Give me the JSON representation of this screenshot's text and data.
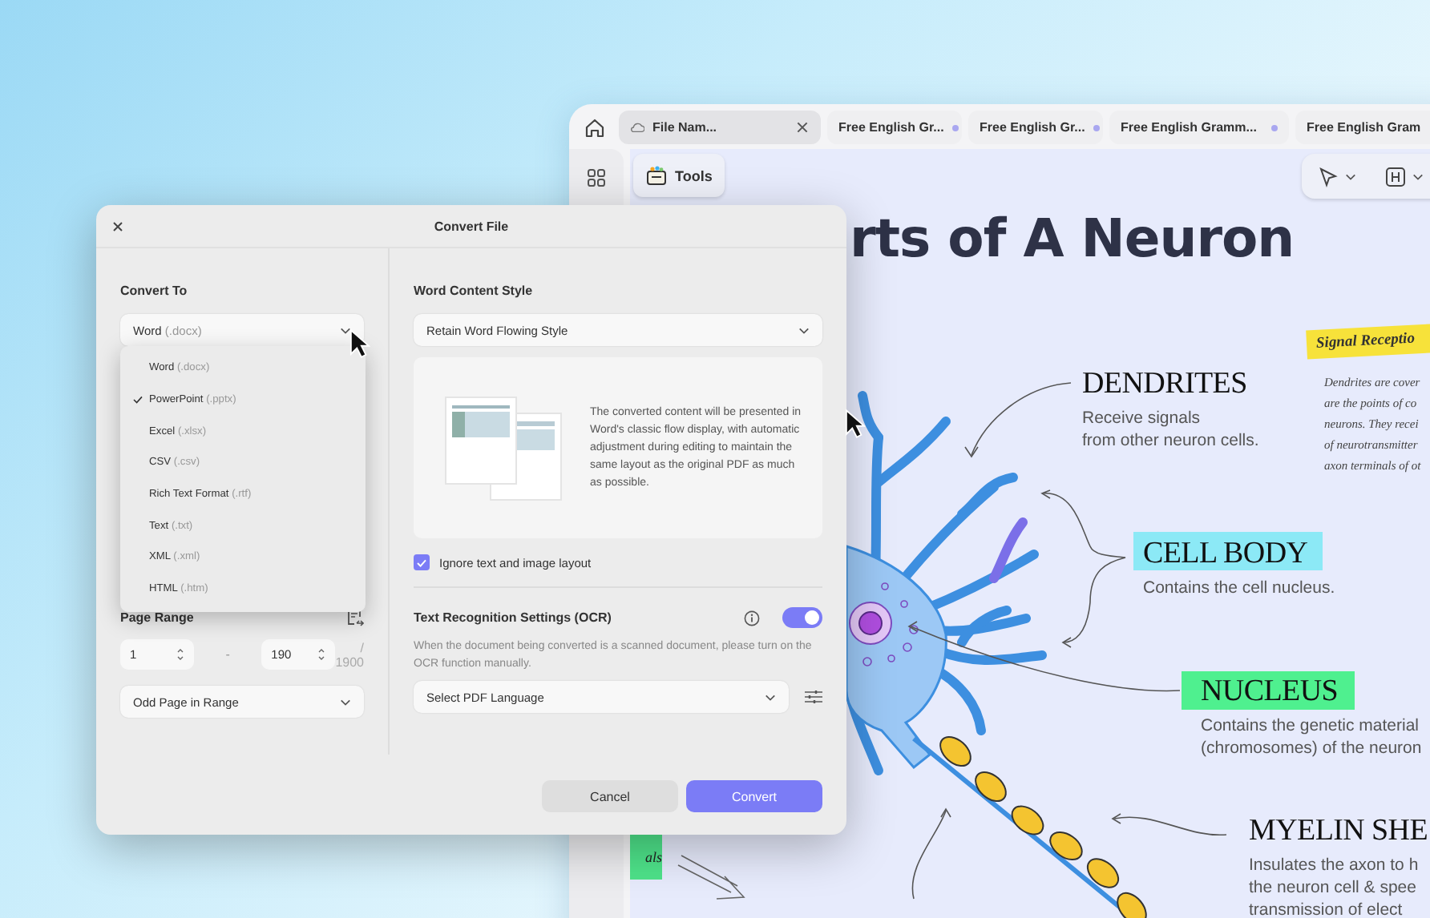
{
  "app": {
    "tabs": [
      {
        "kind": "cloud",
        "label": "File Nam...",
        "selected": true,
        "unsaved": false
      },
      {
        "kind": "local",
        "label": "Free English Gr...",
        "selected": false,
        "unsaved": true
      },
      {
        "kind": "local",
        "label": "Free English Gr...",
        "selected": false,
        "unsaved": true
      },
      {
        "kind": "local",
        "label": "Free English Gramm...",
        "selected": false,
        "unsaved": true
      },
      {
        "kind": "local",
        "label": "Free English Gram",
        "selected": false,
        "unsaved": false
      }
    ],
    "toolbar": {
      "tools_label": "Tools"
    },
    "document": {
      "title": "rts of A Neuron",
      "note": {
        "heading": "Signal Receptio",
        "lines": [
          "Dendrites are cover",
          "are the points of co",
          "neurons. They recei",
          "of neurotransmitter",
          "axon terminals of ot"
        ]
      },
      "parts": [
        {
          "kind": "plain",
          "heading": "DENDRITES",
          "lines": [
            "Receive signals",
            "from other neuron cells."
          ]
        },
        {
          "kind": "highlight",
          "color": "#8ce9f6",
          "heading": "CELL BODY",
          "lines": [
            "Contains the cell nucleus."
          ]
        },
        {
          "kind": "highlight",
          "color": "#4ff08f",
          "heading": "NUCLEUS",
          "lines": [
            "Contains the genetic material",
            "(chromosomes) of the neuron"
          ]
        },
        {
          "kind": "plain",
          "heading": "MYELIN SHE",
          "lines": [
            "Insulates the axon to h",
            "the neuron cell & spee",
            "transmission of elect"
          ]
        }
      ],
      "sticky": {
        "text": "als"
      }
    }
  },
  "dialog": {
    "title": "Convert File",
    "convert_to": {
      "label": "Convert To",
      "value": {
        "name": "Word",
        "ext": "(.docx)"
      },
      "options": [
        {
          "name": "Word",
          "ext": "(.docx)",
          "selected": false
        },
        {
          "name": "PowerPoint",
          "ext": "(.pptx)",
          "selected": true
        },
        {
          "name": "Excel",
          "ext": "(.xlsx)",
          "selected": false
        },
        {
          "name": "CSV",
          "ext": "(.csv)",
          "selected": false
        },
        {
          "name": "Rich Text Format",
          "ext": "(.rtf)",
          "selected": false
        },
        {
          "name": "Text",
          "ext": "(.txt)",
          "selected": false
        },
        {
          "name": "XML",
          "ext": "(.xml)",
          "selected": false
        },
        {
          "name": "HTML",
          "ext": "(.htm)",
          "selected": false
        }
      ]
    },
    "page_range": {
      "label": "Page Range",
      "from": "1",
      "separator": "-",
      "to": "190",
      "total": "/ 1900",
      "subset": "Odd Page in Range"
    },
    "content_style": {
      "label": "Word Content Style",
      "value": "Retain Word Flowing Style",
      "description": "The converted content will be presented in Word's classic flow display, with automatic adjustment during editing to maintain the same layout as the original PDF as much as possible."
    },
    "ignore_layout": {
      "label": "Ignore text and image layout",
      "checked": true
    },
    "ocr": {
      "label": "Text Recognition Settings (OCR)",
      "on": true,
      "hint": "When the document being converted is a scanned document, please turn on the OCR function manually.",
      "language": {
        "placeholder": "Select PDF Language"
      }
    },
    "buttons": [
      {
        "label": "Cancel",
        "kind": "secondary"
      },
      {
        "label": "Convert",
        "kind": "primary"
      }
    ]
  }
}
